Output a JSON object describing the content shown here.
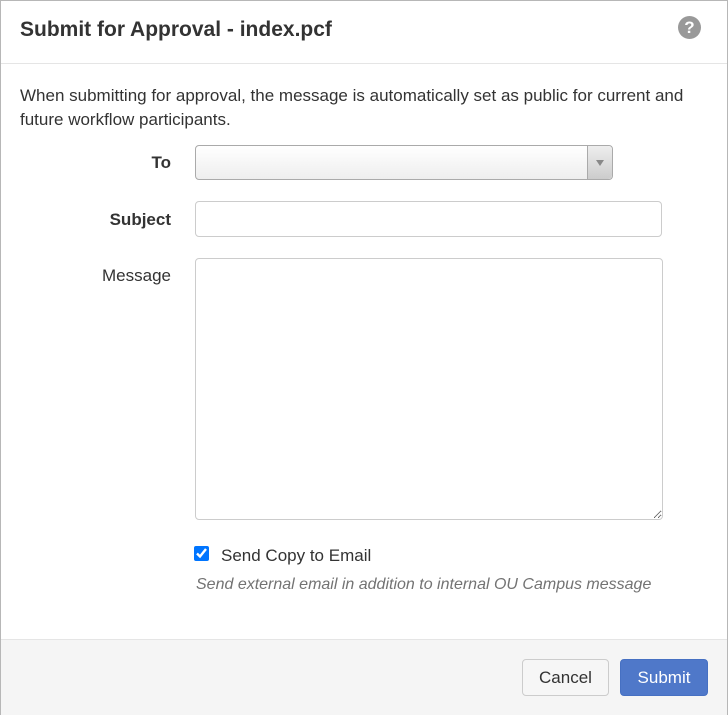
{
  "dialog": {
    "title": "Submit for Approval - index.pcf",
    "help_icon": "question-circle-icon",
    "intro_text": "When submitting for approval, the message is automatically set as public for current and future workflow participants."
  },
  "form": {
    "to": {
      "label": "To",
      "value": ""
    },
    "subject": {
      "label": "Subject",
      "value": "",
      "placeholder": ""
    },
    "message": {
      "label": "Message",
      "value": ""
    },
    "send_copy": {
      "label": "Send Copy to Email",
      "checked": true,
      "help_text": "Send external email in addition to internal OU Campus message"
    }
  },
  "footer": {
    "cancel_label": "Cancel",
    "submit_label": "Submit"
  },
  "colors": {
    "primary_button": "#4f78c9",
    "footer_background": "#f5f5f5",
    "help_icon": "#999999"
  }
}
